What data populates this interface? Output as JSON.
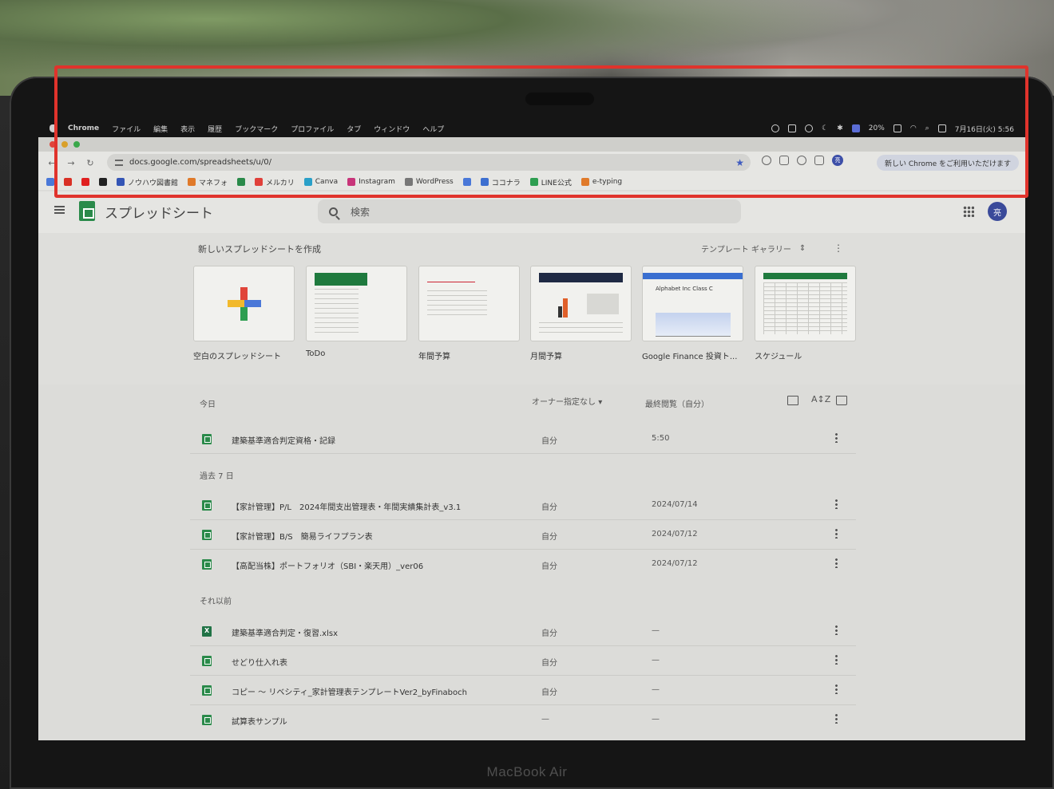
{
  "menubar": {
    "app": "Chrome",
    "items": [
      "ファイル",
      "編集",
      "表示",
      "履歴",
      "ブックマーク",
      "プロファイル",
      "タブ",
      "ウィンドウ",
      "ヘルプ"
    ],
    "battery": "20%",
    "datetime": "7月16日(火) 5:56"
  },
  "browser": {
    "url": "docs.google.com/spreadsheets/u/0/",
    "promo": "新しい Chrome をご利用いただけます",
    "avatar": "亮",
    "bookmarks": [
      {
        "label": "",
        "icon": "calendar-icon",
        "color": "#4a78d8"
      },
      {
        "label": "",
        "icon": "gmail-icon",
        "color": "#d93025"
      },
      {
        "label": "",
        "icon": "youtube-icon",
        "color": "#e02020"
      },
      {
        "label": "",
        "icon": "x-icon",
        "color": "#222222"
      },
      {
        "label": "ノウハウ図書館",
        "icon": "bookmark-icon",
        "color": "#3455b5"
      },
      {
        "label": "マネフォ",
        "icon": "moneyforward-icon",
        "color": "#e07a2a"
      },
      {
        "label": "",
        "icon": "sheets-icon",
        "color": "#2a8a4a"
      },
      {
        "label": "メルカリ",
        "icon": "mercari-icon",
        "color": "#e0403a"
      },
      {
        "label": "Canva",
        "icon": "canva-icon",
        "color": "#2aa0c8"
      },
      {
        "label": "Instagram",
        "icon": "instagram-icon",
        "color": "#c8357a"
      },
      {
        "label": "WordPress",
        "icon": "wordpress-icon",
        "color": "#777777"
      },
      {
        "label": "",
        "icon": "pencil-icon",
        "color": "#4a78d8"
      },
      {
        "label": "ココナラ",
        "icon": "coconala-icon",
        "color": "#3d6fd0"
      },
      {
        "label": "LINE公式",
        "icon": "line-icon",
        "color": "#2e9e51"
      },
      {
        "label": "e-typing",
        "icon": "etyping-icon",
        "color": "#e07a2a"
      }
    ]
  },
  "header": {
    "title": "スプレッドシート",
    "search_placeholder": "検索",
    "avatar": "亮"
  },
  "templates": {
    "heading": "新しいスプレッドシートを作成",
    "gallery": "テンプレート ギャラリー",
    "items": [
      {
        "name": "空白のスプレッドシート"
      },
      {
        "name": "ToDo"
      },
      {
        "name": "年間予算"
      },
      {
        "name": "月間予算"
      },
      {
        "name": "Google Finance 投資ト..."
      },
      {
        "name": "スケジュール"
      }
    ]
  },
  "list": {
    "today": "今日",
    "owner_filter": "オーナー指定なし",
    "last_opened": "最終閲覧（自分）",
    "past7": "過去 7 日",
    "earlier": "それ以前",
    "rows": [
      {
        "name": "建築基準適合判定資格・記録",
        "owner": "自分",
        "date": "5:50",
        "type": "sheets"
      },
      {
        "name": "【家計管理】P/L　2024年間支出管理表・年間実績集計表_v3.1",
        "owner": "自分",
        "date": "2024/07/14",
        "type": "sheets"
      },
      {
        "name": "【家計管理】B/S　簡易ライフプラン表",
        "owner": "自分",
        "date": "2024/07/12",
        "type": "sheets"
      },
      {
        "name": "【高配当株】ポートフォリオ（SBI・楽天用）_ver06",
        "owner": "自分",
        "date": "2024/07/12",
        "type": "sheets"
      },
      {
        "name": "建築基準適合判定・復習.xlsx",
        "owner": "自分",
        "date": "—",
        "type": "excel"
      },
      {
        "name": "せどり仕入れ表",
        "owner": "自分",
        "date": "—",
        "type": "sheets"
      },
      {
        "name": "コピー ～ リベシティ_家計管理表テンプレートVer2_byFinaboch",
        "owner": "自分",
        "date": "—",
        "type": "sheets"
      },
      {
        "name": "試算表サンプル",
        "owner": "—",
        "date": "—",
        "type": "sheets"
      }
    ]
  },
  "device": {
    "brand": "MacBook Air"
  }
}
